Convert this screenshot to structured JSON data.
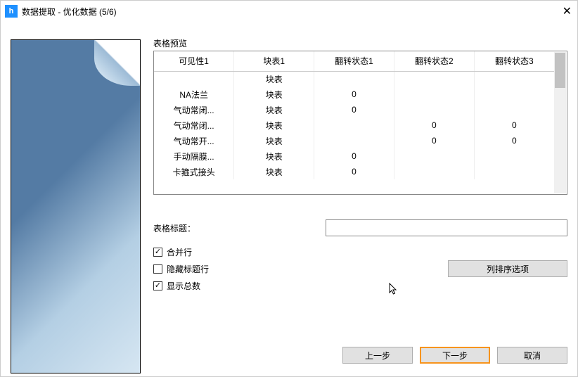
{
  "titlebar": {
    "icon_letter": "h",
    "title": "数据提取 - 优化数据 (5/6)"
  },
  "preview_label": "表格预览",
  "table": {
    "headers": [
      "可见性1",
      "块表1",
      "翻转状态1",
      "翻转状态2",
      "翻转状态3"
    ],
    "rows": [
      [
        "",
        "块表",
        "",
        "",
        ""
      ],
      [
        "NA法兰",
        "块表",
        "0",
        "",
        ""
      ],
      [
        "气动常闭...",
        "块表",
        "0",
        "",
        ""
      ],
      [
        "气动常闭...",
        "块表",
        "",
        "0",
        "0"
      ],
      [
        "气动常开...",
        "块表",
        "",
        "0",
        "0"
      ],
      [
        "手动隔膜...",
        "块表",
        "0",
        "",
        ""
      ],
      [
        "卡箍式接头",
        "块表",
        "0",
        "",
        ""
      ]
    ]
  },
  "form": {
    "title_label": "表格标题：",
    "title_value": "",
    "merge_rows": "合并行",
    "hide_header": "隐藏标题行",
    "show_totals": "显示总数",
    "sort_btn": "列排序选项"
  },
  "buttons": {
    "prev": "上一步",
    "next": "下一步",
    "cancel": "取消"
  }
}
